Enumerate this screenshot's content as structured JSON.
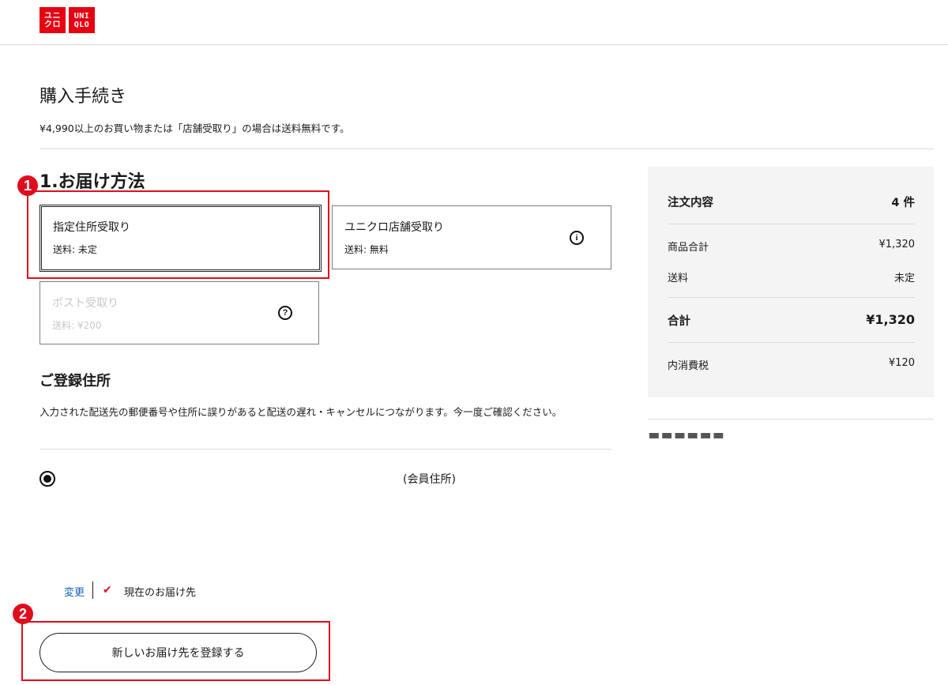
{
  "brand": {
    "logo_left_line1": "ユニ",
    "logo_left_line2": "クロ",
    "logo_right_line1": "UNI",
    "logo_right_line2": "QLO",
    "accent_color": "#e60012"
  },
  "page": {
    "title": "購入手続き",
    "notice": "¥4,990以上のお買い物または「店舗受取り」の場合は送料無料です。"
  },
  "delivery": {
    "section_title": "1.お届け方法",
    "options": [
      {
        "title": "指定住所受取り",
        "fee": "送料: 未定",
        "state": "selected"
      },
      {
        "title": "ユニクロ店舗受取り",
        "fee": "送料: 無料",
        "icon": "info-icon",
        "icon_glyph": "i"
      },
      {
        "title": "ポスト受取り",
        "fee": "送料: ¥200",
        "state": "disabled",
        "icon": "help-icon",
        "icon_glyph": "?"
      }
    ]
  },
  "address": {
    "title": "ご登録住所",
    "warning": "入力された配送先の郵便番号や住所に誤りがあると配送の遅れ・キャンセルにつながります。今一度ご確認ください。",
    "member_label": "(会員住所)",
    "change_link": "変更",
    "current_label": "現在のお届け先",
    "check_glyph": "✔",
    "new_address_button": "新しいお届け先を登録する"
  },
  "summary": {
    "title": "注文内容",
    "count": "4 件",
    "subtotal_label": "商品合計",
    "subtotal_value": "¥1,320",
    "shipping_label": "送料",
    "shipping_value": "未定",
    "total_label": "合計",
    "total_value": "¥1,320",
    "tax_label": "内消費税",
    "tax_value": "¥120"
  },
  "annotations": {
    "marker_1": "1",
    "marker_2": "2",
    "marker_color": "#e00d1d"
  }
}
